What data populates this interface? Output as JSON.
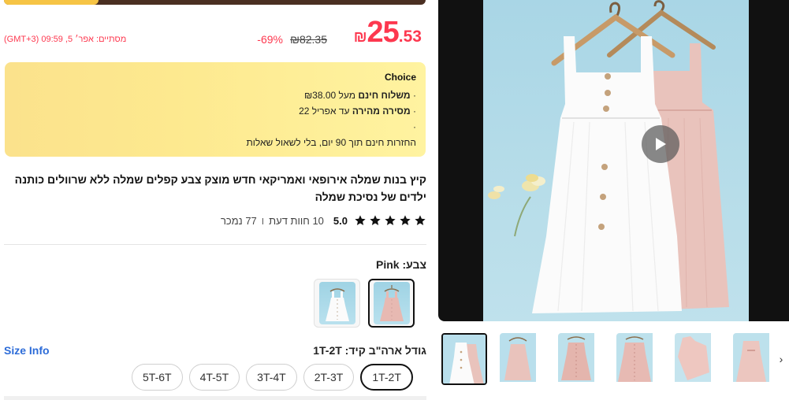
{
  "price": {
    "currency_symbol": "₪",
    "integer": "25",
    "decimal": ".53",
    "old_price": "₪82.35",
    "discount": "69%-",
    "timer_text": "מסתיים: אפר׳ 5, 09:59 (GMT+3)"
  },
  "choice": {
    "title": "Choice",
    "line1_prefix": "· ",
    "line1_bold": "משלוח חינם",
    "line1_rest": " מעל ₪38.00",
    "line2_prefix": "· ",
    "line2_bold": "מסירה מהירה",
    "line2_rest": " עד אפריל 22",
    "line3": "·",
    "line4": "החזרות חינם תוך 90 יום, בלי לשאול שאלות"
  },
  "product": {
    "title": "קיץ בנות שמלה אירופאי ואמריקאי חדש מוצק צבע קפלים שמלה ללא שרוולים כותנה ילדים של נסיכת שמלה"
  },
  "rating": {
    "score": "5.0",
    "stars": 5,
    "reviews": "10 חוות דעת",
    "sold": "77 נמכר",
    "separator": "ו"
  },
  "color": {
    "label": "צבע: Pink",
    "options": [
      "Pink",
      "White"
    ],
    "selected": "Pink"
  },
  "size": {
    "info_link": "Size Info",
    "label": "גודל ארה\"ב קיד: 1T-2T",
    "options": [
      "1T-2T",
      "2T-3T",
      "3T-4T",
      "4T-5T",
      "5T-6T"
    ],
    "selected": "1T-2T"
  },
  "gallery": {
    "thumbnails": [
      "white-pink-dresses",
      "pink-dress-front",
      "pink-dress-hanger",
      "pink-dress-detail",
      "pink-dress-flat",
      "pink-dress-back"
    ],
    "active_index": 0,
    "next_icon": "chevron-right-icon",
    "play_icon": "play-icon"
  },
  "colors": {
    "accent_red": "#fd384f",
    "link_blue": "#2d6cd8",
    "choice_gold": "#fde98f",
    "dress_pink": "#e7b9b2",
    "dress_white": "#fbfbfb",
    "sky_blue": "#b7dde9"
  }
}
